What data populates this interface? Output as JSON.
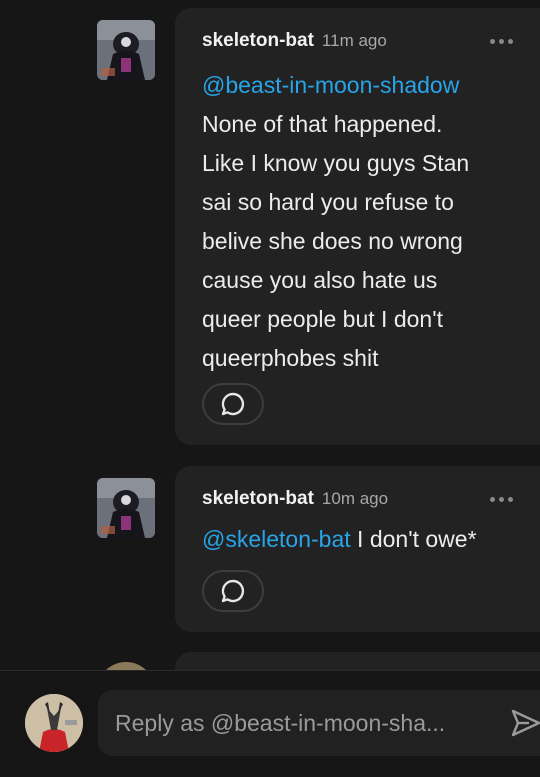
{
  "comments": [
    {
      "username": "skeleton-bat",
      "time": "11m ago",
      "mention": "@beast-in-moon-shadow",
      "lines": [
        "None of that happened.",
        "Like I know you guys Stan",
        "sai so hard you refuse to",
        "belive she does no wrong",
        "cause you also hate us",
        "queer people but I don't",
        "queerphobes shit"
      ]
    },
    {
      "username": "skeleton-bat",
      "time": "10m ago",
      "mention": "@skeleton-bat",
      "text": " I don't owe*"
    }
  ],
  "reply": {
    "placeholder": "Reply as @beast-in-moon-sha..."
  },
  "icons": {
    "more": "more-dots-icon",
    "reply": "speech-bubble-icon",
    "send": "send-arrow-icon"
  },
  "colors": {
    "background": "#161616",
    "bubble": "#222222",
    "mention": "#27a5e8",
    "text": "#ececec",
    "muted": "#a8a8a8"
  }
}
